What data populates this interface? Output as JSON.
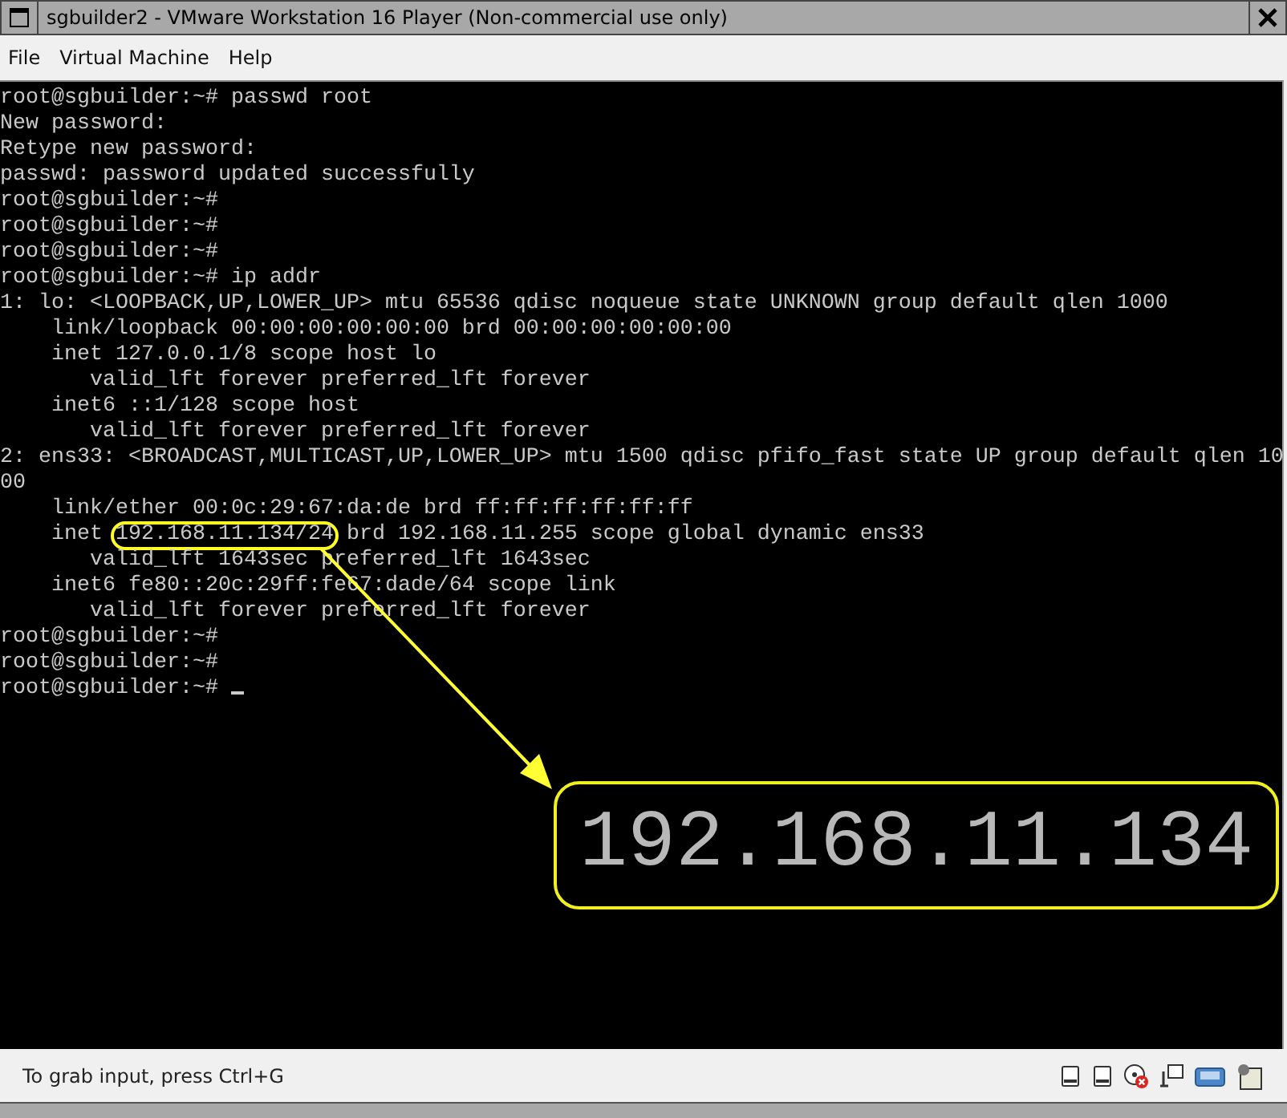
{
  "window": {
    "title": "sgbuilder2 - VMware Workstation 16 Player (Non-commercial use only)"
  },
  "menu": [
    "File",
    "Virtual Machine",
    "Help"
  ],
  "terminal": {
    "lines": [
      {
        "kind": "plain",
        "text": "root@sgbuilder:~# passwd root"
      },
      {
        "kind": "plain",
        "text": "New password:"
      },
      {
        "kind": "plain",
        "text": "Retype new password:"
      },
      {
        "kind": "plain",
        "text": "passwd: password updated successfully"
      },
      {
        "kind": "plain",
        "text": "root@sgbuilder:~#"
      },
      {
        "kind": "plain",
        "text": "root@sgbuilder:~#"
      },
      {
        "kind": "plain",
        "text": "root@sgbuilder:~#"
      },
      {
        "kind": "plain",
        "text": "root@sgbuilder:~# ip addr"
      },
      {
        "kind": "plain",
        "text": "1: lo: <LOOPBACK,UP,LOWER_UP> mtu 65536 qdisc noqueue state UNKNOWN group default qlen 1000"
      },
      {
        "kind": "plain",
        "text": "    link/loopback 00:00:00:00:00:00 brd 00:00:00:00:00:00"
      },
      {
        "kind": "plain",
        "text": "    inet 127.0.0.1/8 scope host lo"
      },
      {
        "kind": "plain",
        "text": "       valid_lft forever preferred_lft forever"
      },
      {
        "kind": "plain",
        "text": "    inet6 ::1/128 scope host"
      },
      {
        "kind": "plain",
        "text": "       valid_lft forever preferred_lft forever"
      },
      {
        "kind": "plain",
        "text": "2: ens33: <BROADCAST,MULTICAST,UP,LOWER_UP> mtu 1500 qdisc pfifo_fast state UP group default qlen 10"
      },
      {
        "kind": "plain",
        "text": "00"
      },
      {
        "kind": "plain",
        "text": "    link/ether 00:0c:29:67:da:de brd ff:ff:ff:ff:ff:ff"
      },
      {
        "kind": "circled",
        "before": "    inet ",
        "circled": "192.168.11.134/24",
        "after": " brd 192.168.11.255 scope global dynamic ens33"
      },
      {
        "kind": "plain",
        "text": "       valid_lft 1643sec preferred_lft 1643sec"
      },
      {
        "kind": "plain",
        "text": "    inet6 fe80::20c:29ff:fe67:dade/64 scope link"
      },
      {
        "kind": "plain",
        "text": "       valid_lft forever preferred_lft forever"
      },
      {
        "kind": "plain",
        "text": "root@sgbuilder:~#"
      },
      {
        "kind": "plain",
        "text": "root@sgbuilder:~#"
      },
      {
        "kind": "prompt",
        "text": "root@sgbuilder:~# "
      }
    ]
  },
  "callout": {
    "text": "192.168.11.134"
  },
  "status_bar": {
    "text": "To grab input, press Ctrl+G"
  }
}
